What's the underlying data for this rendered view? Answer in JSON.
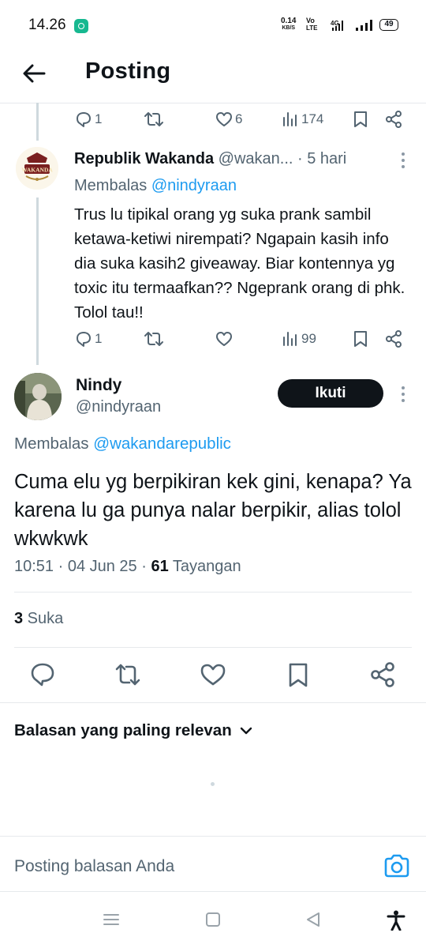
{
  "status_bar": {
    "time": "14.26",
    "net_speed_value": "0.14",
    "net_speed_unit": "KB/S",
    "volte_top": "Vo",
    "volte_bottom": "LTE",
    "network": "4G",
    "battery": "49"
  },
  "header": {
    "title": "Posting"
  },
  "parent_post_actions": {
    "replies": "1",
    "likes": "6",
    "views": "174"
  },
  "reply": {
    "name": "Republik Wakanda",
    "handle": "@wakan...",
    "time": "· 5 hari",
    "replying_prefix": "Membalas ",
    "replying_to": "@nindyraan",
    "text": "Trus lu tipikal orang yg suka prank sambil ketawa-ketiwi nirempati? Ngapain kasih info dia suka kasih2 giveaway. Biar kontennya yg toxic itu termaafkan?? Ngeprank orang di phk. Tolol tau!!",
    "actions": {
      "replies": "1",
      "likes": "",
      "views": "99"
    },
    "avatar_text": "WAKANDA"
  },
  "main_post": {
    "name": "Nindy",
    "handle": "@nindyraan",
    "follow_label": "Ikuti",
    "replying_prefix": "Membalas ",
    "replying_to": "@wakandarepublic",
    "text": "Cuma elu yg berpikiran kek gini, kenapa? Ya karena lu ga punya nalar berpikir, alias tolol wkwkwk",
    "time": "10:51 · 04 Jun 25 · ",
    "views_count": "61",
    "views_label": " Tayangan",
    "likes_count": "3",
    "likes_label": " Suka"
  },
  "replies_section": {
    "sort_label": "Balasan yang paling relevan"
  },
  "composer": {
    "placeholder": "Posting balasan Anda"
  },
  "colors": {
    "accent": "#1d9bf0",
    "text": "#0f1419",
    "muted": "#536471",
    "button": "#0f1419"
  }
}
